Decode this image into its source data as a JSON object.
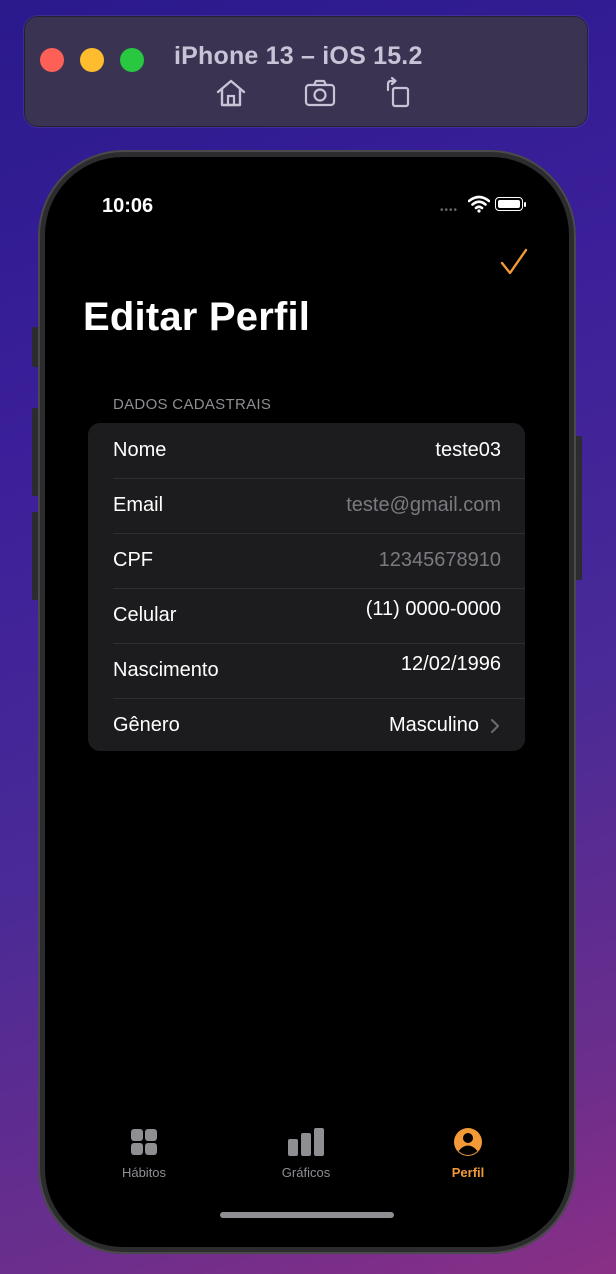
{
  "simulator": {
    "title": "iPhone 13 – iOS 15.2",
    "toolbar_icons": [
      "home-icon",
      "screenshot-icon",
      "rotate-icon"
    ]
  },
  "status_bar": {
    "time": "10:06"
  },
  "nav": {
    "done_icon": "checkmark-icon",
    "accent_color": "#f29a38"
  },
  "page": {
    "title": "Editar Perfil"
  },
  "section": {
    "header": "DADOS CADASTRAIS"
  },
  "fields": [
    {
      "label": "Nome",
      "value": "teste03"
    },
    {
      "label": "Email",
      "value": "teste@gmail.com"
    },
    {
      "label": "CPF",
      "value": "12345678910"
    },
    {
      "label": "Celular",
      "value": "(11) 0000-0000"
    },
    {
      "label": "Nascimento",
      "value": "12/02/1996"
    },
    {
      "label": "Gênero",
      "value": "Masculino"
    }
  ],
  "tabs": [
    {
      "label": "Hábitos",
      "icon": "grid-icon"
    },
    {
      "label": "Gráficos",
      "icon": "bar-chart-icon"
    },
    {
      "label": "Perfil",
      "icon": "person-circle-icon",
      "active": true
    }
  ]
}
